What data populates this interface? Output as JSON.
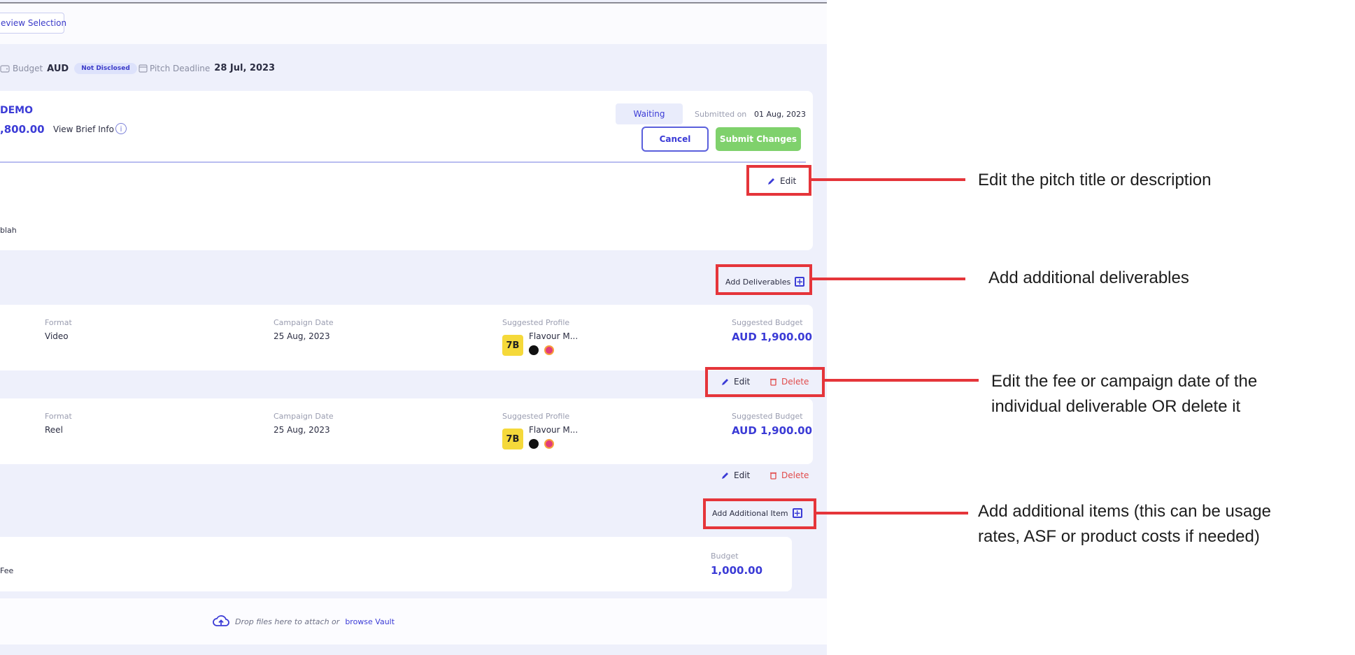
{
  "review_selection": "eview Selection",
  "summary": {
    "budget_label": "Budget",
    "currency": "AUD",
    "budget_status": "Not Disclosed",
    "deadline_label": "Pitch Deadline",
    "deadline_value": "28 Jul, 2023"
  },
  "pitch": {
    "name": "DEMO",
    "amount": ",800.00",
    "view_brief": "View Brief Info",
    "status": "Waiting",
    "submitted_label": "Submitted on",
    "submitted_date": "01 Aug, 2023",
    "cancel_label": "Cancel",
    "submit_label": "Submit Changes",
    "edit_label": "Edit",
    "description_snippet": "blah"
  },
  "deliverables": {
    "add_label": "Add Deliverables",
    "items": [
      {
        "format_label": "Format",
        "format": "Video",
        "date_label": "Campaign Date",
        "date": "25 Aug, 2023",
        "profile_label": "Suggested Profile",
        "profile_name": "Flavour M...",
        "budget_label": "Suggested Budget",
        "budget": "AUD 1,900.00",
        "edit_label": "Edit",
        "delete_label": "Delete"
      },
      {
        "format_label": "Format",
        "format": "Reel",
        "date_label": "Campaign Date",
        "date": "25 Aug, 2023",
        "profile_label": "Suggested Profile",
        "profile_name": "Flavour M...",
        "budget_label": "Suggested Budget",
        "budget": "AUD 1,900.00",
        "edit_label": "Edit",
        "delete_label": "Delete"
      }
    ]
  },
  "additional": {
    "add_label": "Add Additional Item",
    "item_name": "Fee",
    "budget_label": "Budget",
    "budget_value": "1,000.00"
  },
  "upload": {
    "text": "Drop files here to attach or",
    "link": "browse Vault"
  },
  "annotations": [
    "Edit the pitch title or description",
    "Add additional deliverables",
    "Edit the fee or campaign date of the",
    "individual deliverable OR delete it",
    "Add additional items (this can be usage",
    "rates, ASF or product costs if needed)"
  ],
  "colors": {
    "accent": "#3b3bd6",
    "submit_green": "#7fd16c",
    "delete_red": "#e14b4b",
    "annotation_red": "#e5353a"
  },
  "icons": [
    "wallet-icon",
    "calendar-icon",
    "info-icon",
    "pencil-icon",
    "trash-icon",
    "plus-square-icon",
    "cloud-upload-icon",
    "tiktok-icon",
    "instagram-icon"
  ]
}
